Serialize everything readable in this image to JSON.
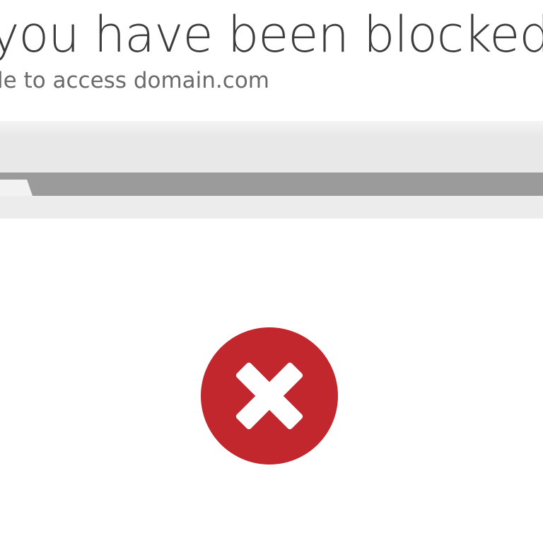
{
  "page": {
    "headline": "you have been blocked",
    "subhead": "le to access domain.com"
  },
  "error_badge": {
    "icon": "close-icon",
    "circle_color": "#c1272d",
    "cross_color": "#ffffff"
  }
}
